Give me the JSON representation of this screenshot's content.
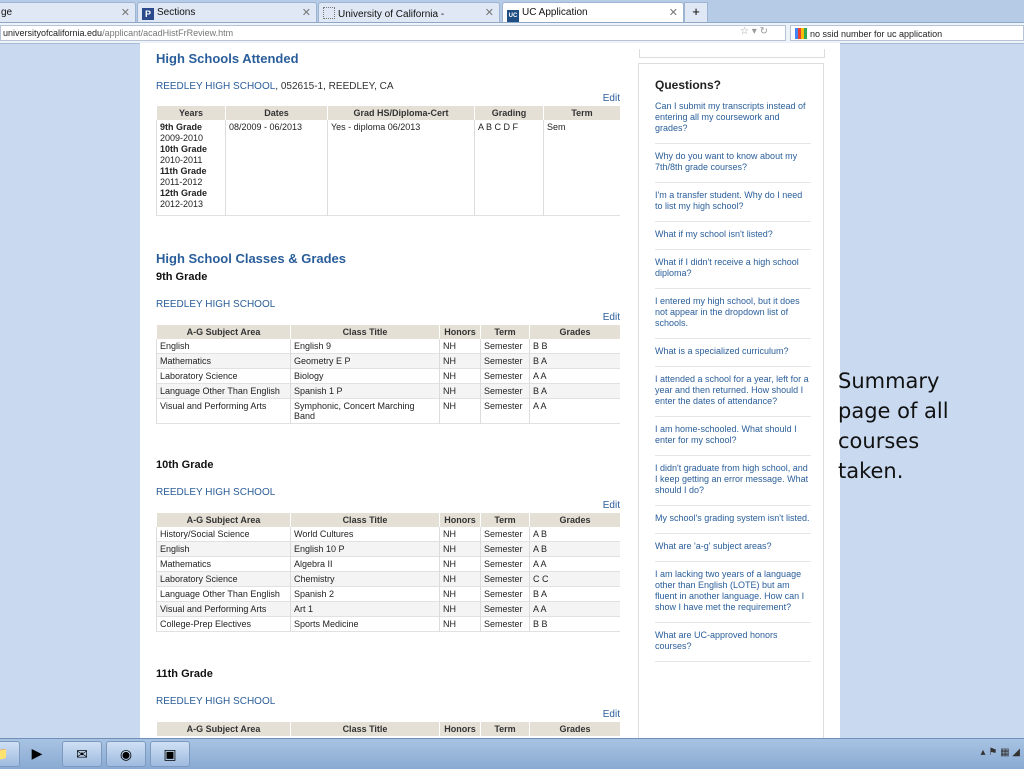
{
  "browser": {
    "tabs": [
      {
        "label": "ge",
        "active": false
      },
      {
        "label": "Sections",
        "active": false,
        "icon": "p-icon"
      },
      {
        "label": "University of California -",
        "active": false,
        "icon": "loading-icon"
      },
      {
        "label": "UC Application",
        "active": true,
        "icon": "uc-icon"
      }
    ],
    "url_host": "universityofcalifornia.edu",
    "url_path": "/applicant/acadHistFrReview.htm",
    "search_text": "no ssid number for uc application"
  },
  "high_schools": {
    "heading": "High Schools Attended",
    "school_name": "REEDLEY HIGH SCHOOL",
    "school_detail": ", 052615-1, REEDLEY, CA",
    "edit": "Edit",
    "columns": [
      "Years",
      "Dates",
      "Grad HS/Diploma-Cert",
      "Grading",
      "Term"
    ],
    "years": [
      {
        "grade": "9th Grade",
        "year": "2009-2010"
      },
      {
        "grade": "10th Grade",
        "year": "2010-2011"
      },
      {
        "grade": "11th Grade",
        "year": "2011-2012"
      },
      {
        "grade": "12th Grade",
        "year": "2012-2013"
      }
    ],
    "dates": "08/2009 - 06/2013",
    "grad": "Yes - diploma 06/2013",
    "grading": "A B C D F",
    "term": "Sem"
  },
  "classes": {
    "heading": "High School Classes & Grades",
    "columns": [
      "A-G Subject Area",
      "Class Title",
      "Honors",
      "Term",
      "Grades"
    ],
    "edit": "Edit",
    "grades": [
      {
        "title": "9th Grade",
        "school": "REEDLEY HIGH SCHOOL",
        "rows": [
          [
            "English",
            "English 9",
            "NH",
            "Semester",
            "B B"
          ],
          [
            "Mathematics",
            "Geometry E P",
            "NH",
            "Semester",
            "B A"
          ],
          [
            "Laboratory Science",
            "Biology",
            "NH",
            "Semester",
            "A A"
          ],
          [
            "Language Other Than English",
            "Spanish 1 P",
            "NH",
            "Semester",
            "B A"
          ],
          [
            "Visual and Performing Arts",
            "Symphonic, Concert Marching Band",
            "NH",
            "Semester",
            "A A"
          ]
        ]
      },
      {
        "title": "10th Grade",
        "school": "REEDLEY HIGH SCHOOL",
        "rows": [
          [
            "History/Social Science",
            "World Cultures",
            "NH",
            "Semester",
            "A B"
          ],
          [
            "English",
            "English 10 P",
            "NH",
            "Semester",
            "A B"
          ],
          [
            "Mathematics",
            "Algebra II",
            "NH",
            "Semester",
            "A A"
          ],
          [
            "Laboratory Science",
            "Chemistry",
            "NH",
            "Semester",
            "C C"
          ],
          [
            "Language Other Than English",
            "Spanish 2",
            "NH",
            "Semester",
            "B A"
          ],
          [
            "Visual and Performing Arts",
            "Art 1",
            "NH",
            "Semester",
            "A A"
          ],
          [
            "College-Prep Electives",
            "Sports Medicine",
            "NH",
            "Semester",
            "B B"
          ]
        ]
      },
      {
        "title": "11th Grade",
        "school": "REEDLEY HIGH SCHOOL",
        "rows": []
      }
    ]
  },
  "sidebar": {
    "heading": "Questions?",
    "questions": [
      "Can I submit my transcripts instead of entering all my coursework and grades?",
      "Why do you want to know about my 7th/8th grade courses?",
      "I'm a transfer student. Why do I need to list my high school?",
      "What if my school isn't listed?",
      "What if I didn't receive a high school diploma?",
      "I entered my high school, but it does not appear in the dropdown list of schools.",
      "What is a specialized curriculum?",
      "I attended a school for a year, left for a year and then returned. How should I enter the dates of attendance?",
      "I am home-schooled. What should I enter for my school?",
      "I didn't graduate from high school, and I keep getting an error message. What should I do?",
      "My school's grading system isn't listed.",
      "What are 'a-g' subject areas?",
      "I am lacking two years of a language other than English (LOTE) but am fluent in another language. How can I show I have met the requirement?",
      "What are UC-approved honors courses?"
    ]
  },
  "annotation": "Summary page of all courses taken.",
  "taskbar": {
    "buttons": [
      "explorer-icon",
      "media-player-icon",
      "outlook-icon",
      "firefox-icon",
      "powerpoint-icon"
    ]
  }
}
